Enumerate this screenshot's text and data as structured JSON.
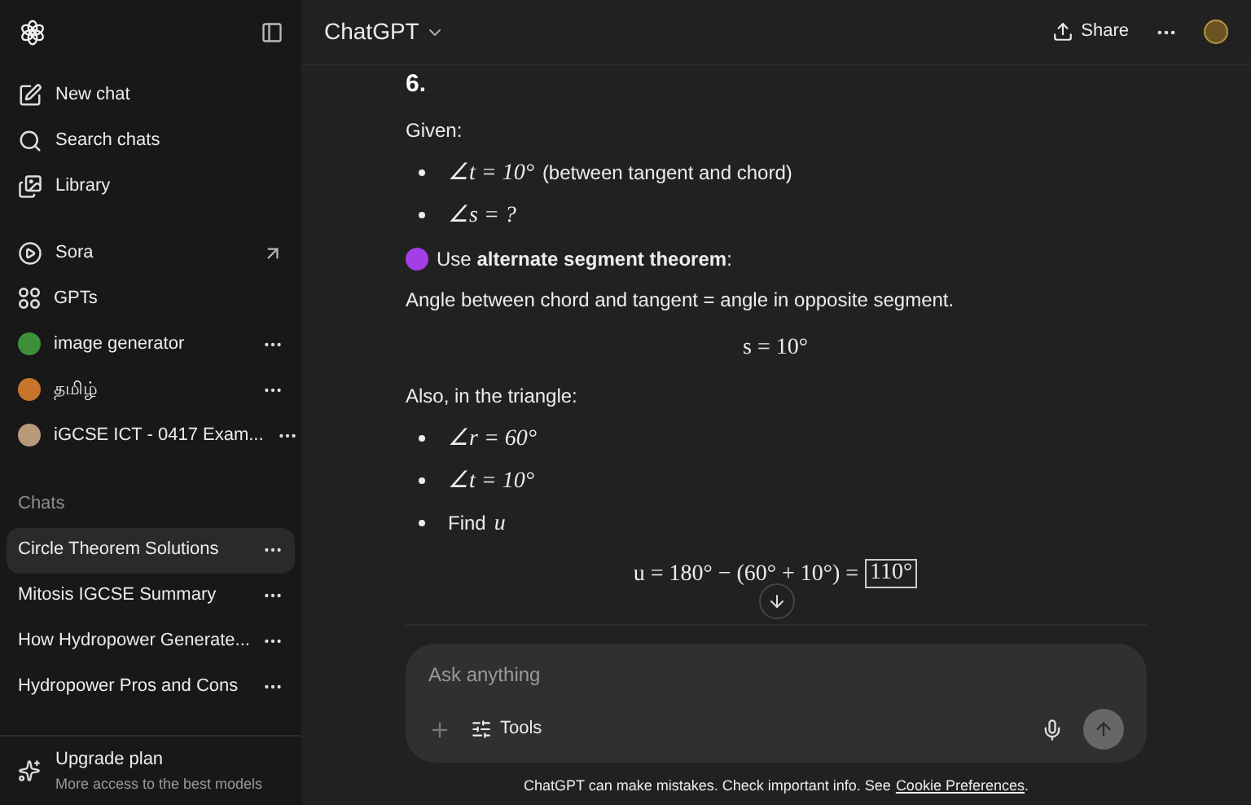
{
  "sidebar": {
    "nav": [
      {
        "kind": "new",
        "label": "New chat"
      },
      {
        "kind": "search",
        "label": "Search chats"
      },
      {
        "kind": "library",
        "label": "Library"
      }
    ],
    "apps": [
      {
        "kind": "sora",
        "label": "Sora"
      },
      {
        "kind": "gpts",
        "label": "GPTs"
      },
      {
        "kind": "gpt",
        "label": "image generator",
        "color": "#3f8f3a"
      },
      {
        "kind": "gpt",
        "label": "தமிழ்",
        "color": "#c8742a"
      },
      {
        "kind": "gpt",
        "label": "iGCSE ICT - 0417 Exam...",
        "color": "#b89a7a"
      }
    ],
    "chats_heading": "Chats",
    "chats": [
      {
        "label": "Circle Theorem Solutions",
        "selected": true
      },
      {
        "label": "Mitosis IGCSE Summary",
        "selected": false
      },
      {
        "label": "How Hydropower Generate...",
        "selected": false
      },
      {
        "label": "Hydropower Pros and Cons",
        "selected": false
      }
    ],
    "upgrade": {
      "title": "Upgrade plan",
      "subtitle": "More access to the best models"
    }
  },
  "header": {
    "model": "ChatGPT",
    "share": "Share"
  },
  "message": [
    {
      "kind": "heading",
      "text": "6."
    },
    {
      "kind": "para",
      "text": "Given:"
    },
    {
      "kind": "bullets",
      "items": [
        [
          {
            "kind": "math",
            "text": "∠t = 10°"
          },
          {
            "kind": "text",
            "text": "(between tangent and chord)"
          }
        ],
        [
          {
            "kind": "math",
            "text": "∠s = ?"
          }
        ]
      ]
    },
    {
      "kind": "emoji_para",
      "text": "Use **alternate segment theorem**:"
    },
    {
      "kind": "para",
      "text": "Angle between chord and tangent = angle in opposite segment."
    },
    {
      "kind": "display",
      "text": "s = 10°"
    },
    {
      "kind": "para",
      "text": "Also, in the triangle:"
    },
    {
      "kind": "bullets",
      "items": [
        [
          {
            "kind": "math",
            "text": "∠r = 60°"
          }
        ],
        [
          {
            "kind": "math",
            "text": "∠t = 10°"
          }
        ],
        [
          {
            "kind": "text",
            "text": "Find"
          },
          {
            "kind": "math",
            "text": "u"
          }
        ]
      ]
    },
    {
      "kind": "display",
      "text": "u = 180° − (60° + 10°) =",
      "boxed": "110°"
    }
  ],
  "composer": {
    "placeholder": "Ask anything",
    "tools": "Tools"
  },
  "footer": {
    "text": "ChatGPT can make mistakes. Check important info. See",
    "link": "Cookie Preferences",
    "end": "."
  }
}
